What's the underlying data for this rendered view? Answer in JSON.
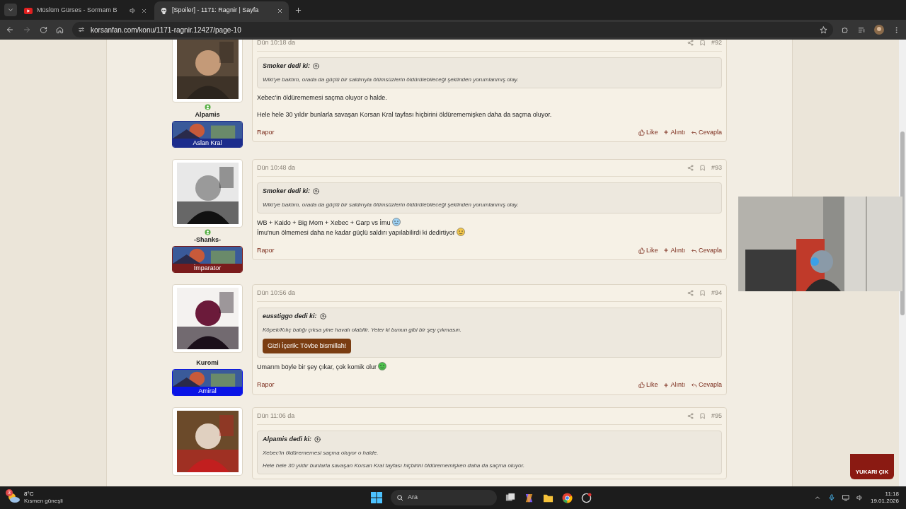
{
  "browser": {
    "tabs": [
      {
        "title": "Müslüm Gürses - Sormam B",
        "kind": "video",
        "audio": true,
        "selected": false
      },
      {
        "title": "[Spoiler] - 1171: Ragnir | Sayfa",
        "kind": "forum",
        "audio": false,
        "selected": true
      }
    ],
    "url": "korsanfan.com/konu/1171-ragnir.12427/page-10"
  },
  "posts": [
    {
      "user": "Alpamis",
      "online": true,
      "rank": {
        "label": "Aslan Kral",
        "color": "#1c2c8c"
      },
      "time": "Dün 10:18 da",
      "number": "#92",
      "quote": {
        "author": "Smoker dedi ki:",
        "paragraphs": [
          "Wiki'ye baktım, orada da güçlü bir saldırıyla ölümsüzlerin öldürülebileceği şeklinden yorumlanmış olay."
        ]
      },
      "body": [
        {
          "lines": [
            {
              "text": "Xebec'in öldürememesi saçma oluyor o halde.",
              "kind": "text"
            }
          ]
        },
        {
          "lines": [
            {
              "text": "Hele hele 30 yıldır bunlarla savaşan Korsan Kral tayfası hiçbirini öldürememişken daha da saçma oluyor.",
              "kind": "text"
            }
          ]
        }
      ],
      "footer": {
        "report": "Rapor",
        "like": "Like",
        "quote": "Alıntı",
        "reply": "Cevapla"
      }
    },
    {
      "user": "-Shanks-",
      "online": true,
      "rank": {
        "label": "İmparator",
        "color": "#7a1c1c"
      },
      "time": "Dün 10:48 da",
      "number": "#93",
      "quote": {
        "author": "Smoker dedi ki:",
        "paragraphs": [
          "Wiki'ye baktım, orada da güçlü bir saldırıyla ölümsüzlerin öldürülebileceği şeklinden yorumlanmış olay."
        ]
      },
      "body": [
        {
          "lines": [
            {
              "text": "WB + Kaido + Big Mom + Xebec + Garp vs İmu",
              "kind": "sweat"
            },
            {
              "text": "İmu'nun ölmemesi daha ne kadar güçlü saldırı yapılabilirdi ki dedirtiyor",
              "kind": "thinking"
            }
          ]
        }
      ],
      "footer": {
        "report": "Rapor",
        "like": "Like",
        "quote": "Alıntı",
        "reply": "Cevapla"
      }
    },
    {
      "user": "Kuromi",
      "online": false,
      "rank": {
        "label": "Amiral",
        "color": "#0a14e6"
      },
      "time": "Dün 10:56 da",
      "number": "#94",
      "quote": {
        "author": "eusstiggo dedi ki:",
        "paragraphs": [
          "Köpek/Kılıç balığı çıksa yine havalı olabilir. Yeter ki bunun gibi bir şey çıkmasın."
        ],
        "spoiler": "Gizli İçerik: Tövbe bismillah!"
      },
      "body": [
        {
          "lines": [
            {
              "text": "Umarım böyle bir şey çıkar, çok komik olur",
              "kind": "grin"
            }
          ]
        }
      ],
      "footer": {
        "report": "Rapor",
        "like": "Like",
        "quote": "Alıntı",
        "reply": "Cevapla"
      }
    },
    {
      "online": false,
      "time": "Dün 11:06 da",
      "number": "#95",
      "quote": {
        "author": "Alpamis dedi ki:",
        "paragraphs": [
          "Xebec'in öldürememesi saçma oluyor o halde.",
          "Hele hele 30 yıldır bunlarla savaşan Korsan Kral tayfası hiçbirini öldürememişken daha da saçma oluyor."
        ]
      }
    }
  ],
  "scroll_top": "YUKARI ÇIK",
  "taskbar": {
    "temperature": "8°C",
    "weather": "Kısmen güneşli",
    "badge": "3",
    "search": "Ara",
    "time": "11:18",
    "date": "19.01.2026"
  }
}
